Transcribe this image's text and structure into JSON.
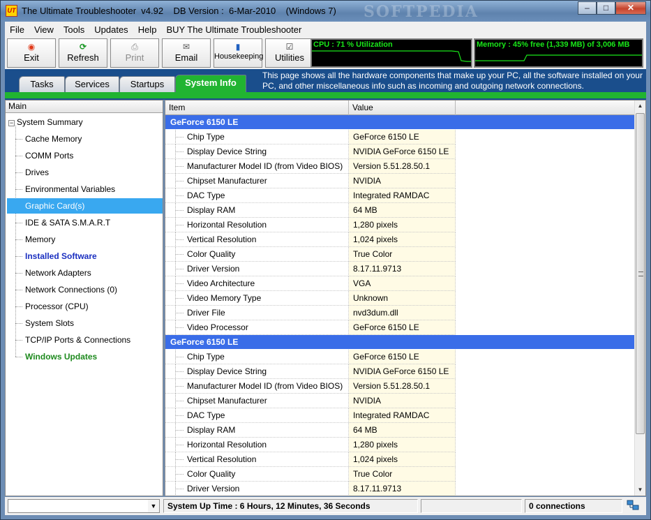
{
  "window": {
    "title": "The Ultimate Troubleshooter  v4.92    DB Version :  6-Mar-2010    (Windows 7)",
    "watermark": "SOFTPEDIA",
    "icon_text": "UT"
  },
  "menu": [
    "File",
    "View",
    "Tools",
    "Updates",
    "Help",
    "BUY The Ultimate Troubleshooter"
  ],
  "toolbar": {
    "exit": "Exit",
    "refresh": "Refresh",
    "print": "Print",
    "email": "Email",
    "housekeeping": "Housekeeping",
    "utilities": "Utilities"
  },
  "monitors": {
    "cpu_label": "CPU :  71 % Utilization",
    "cpu_percent": 71,
    "memory_label": "Memory :  45% free  (1,339 MB) of 3,006 MB",
    "memory_free_percent": 45,
    "graph_color": "#19e619"
  },
  "tabs": {
    "items": [
      "Tasks",
      "Services",
      "Startups",
      "System Info"
    ],
    "active": "System Info",
    "description": "This page shows all the hardware components that make up your PC, all the software installed on your PC, and other miscellaneous info such as incoming and outgoing network connections."
  },
  "tree": {
    "header": "Main",
    "root": "System Summary",
    "items": [
      "Cache Memory",
      "COMM Ports",
      "Drives",
      "Environmental Variables",
      "Graphic Card(s)",
      "IDE & SATA S.M.A.R.T",
      "Memory",
      "Installed Software",
      "Network Adapters",
      "Network Connections (0)",
      "Processor (CPU)",
      "System Slots",
      "TCP/IP Ports & Connections",
      "Windows Updates"
    ],
    "selected": "Graphic Card(s)"
  },
  "grid": {
    "columns": [
      "Item",
      "Value"
    ],
    "groups": [
      {
        "name": "GeForce 6150 LE",
        "rows": [
          [
            "Chip Type",
            "GeForce 6150 LE"
          ],
          [
            "Display Device String",
            "NVIDIA GeForce 6150 LE"
          ],
          [
            "Manufacturer Model ID (from Video BIOS)",
            "Version 5.51.28.50.1"
          ],
          [
            "Chipset Manufacturer",
            "NVIDIA"
          ],
          [
            "DAC Type",
            "Integrated RAMDAC"
          ],
          [
            "Display RAM",
            "64 MB"
          ],
          [
            "Horizontal Resolution",
            "1,280 pixels"
          ],
          [
            "Vertical Resolution",
            "1,024 pixels"
          ],
          [
            "Color Quality",
            "True Color"
          ],
          [
            "Driver Version",
            "8.17.11.9713"
          ],
          [
            "Video Architecture",
            "VGA"
          ],
          [
            "Video Memory Type",
            "Unknown"
          ],
          [
            "Driver File",
            "nvd3dum.dll"
          ],
          [
            "Video Processor",
            "GeForce 6150 LE"
          ]
        ]
      },
      {
        "name": "GeForce 6150 LE",
        "rows": [
          [
            "Chip Type",
            "GeForce 6150 LE"
          ],
          [
            "Display Device String",
            "NVIDIA GeForce 6150 LE"
          ],
          [
            "Manufacturer Model ID (from Video BIOS)",
            "Version 5.51.28.50.1"
          ],
          [
            "Chipset Manufacturer",
            "NVIDIA"
          ],
          [
            "DAC Type",
            "Integrated RAMDAC"
          ],
          [
            "Display RAM",
            "64 MB"
          ],
          [
            "Horizontal Resolution",
            "1,280 pixels"
          ],
          [
            "Vertical Resolution",
            "1,024 pixels"
          ],
          [
            "Color Quality",
            "True Color"
          ],
          [
            "Driver Version",
            "8.17.11.9713"
          ]
        ]
      }
    ]
  },
  "status": {
    "combo_value": "",
    "uptime": "System Up Time :  6 Hours, 12 Minutes, 36 Seconds",
    "connections": "0 connections"
  },
  "colors": {
    "group_row": "#3a6de8",
    "selected_tree": "#39a8f0",
    "tab_active": "#21b431",
    "tab_area": "#1a4e8c",
    "value_cell": "#fffbe5"
  }
}
